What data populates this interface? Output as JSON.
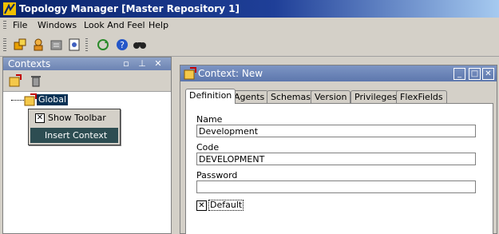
{
  "window": {
    "title": "Topology Manager [Master Repository 1]"
  },
  "menu": [
    "File",
    "Windows",
    "Look And Feel",
    "Help"
  ],
  "toolbar_icons": [
    "topology-icon",
    "security-icon",
    "operator-icon",
    "designer-icon",
    "refresh-icon",
    "help-icon",
    "search-icon"
  ],
  "left_panel": {
    "title": "Contexts",
    "tree": {
      "root": "Global"
    },
    "context_menu": {
      "items": [
        "Show Toolbar",
        "Insert Context"
      ],
      "show_toolbar_checked": true
    }
  },
  "right_panel": {
    "title": "Context: New",
    "tabs": [
      "Definition",
      "Agents",
      "Schemas",
      "Version",
      "Privileges",
      "FlexFields"
    ],
    "active_tab": "Definition",
    "fields": {
      "name_label": "Name",
      "name_value": "Development",
      "code_label": "Code",
      "code_value": "DEVELOPMENT",
      "password_label": "Password",
      "password_value": ""
    },
    "default_label": "Default",
    "default_checked": true
  },
  "colors": {
    "title_bar": "#0a246a",
    "panel_header": "#6c83b3",
    "selection": "#0a3255",
    "context_highlight": "#2d4d52"
  }
}
